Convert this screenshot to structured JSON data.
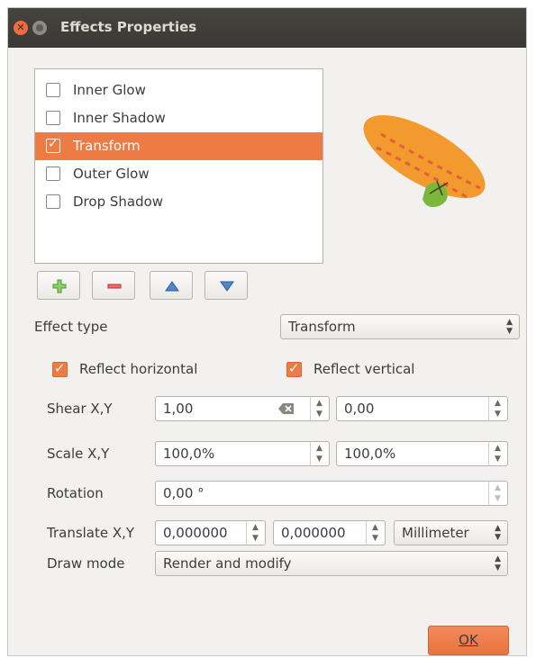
{
  "window": {
    "title": "Effects Properties"
  },
  "effects_list": [
    {
      "label": "Inner Glow",
      "checked": false,
      "selected": false
    },
    {
      "label": "Inner Shadow",
      "checked": false,
      "selected": false
    },
    {
      "label": "Transform",
      "checked": true,
      "selected": true
    },
    {
      "label": "Outer Glow",
      "checked": false,
      "selected": false
    },
    {
      "label": "Drop Shadow",
      "checked": false,
      "selected": false
    }
  ],
  "toolbar": {
    "add_icon": "plus-icon",
    "remove_icon": "minus-icon",
    "up_icon": "arrow-up-icon",
    "down_icon": "arrow-down-icon"
  },
  "effect_type": {
    "label": "Effect type",
    "value": "Transform"
  },
  "reflect": {
    "horizontal_label": "Reflect horizontal",
    "horizontal_checked": true,
    "vertical_label": "Reflect vertical",
    "vertical_checked": true
  },
  "shear": {
    "label": "Shear X,Y",
    "x": "1,00",
    "y": "0,00"
  },
  "scale": {
    "label": "Scale X,Y",
    "x": "100,0%",
    "y": "100,0%"
  },
  "rotation": {
    "label": "Rotation",
    "value": "0,00 °"
  },
  "translate": {
    "label": "Translate X,Y",
    "x": "0,000000",
    "y": "0,000000",
    "unit": "Millimeter"
  },
  "draw_mode": {
    "label": "Draw mode",
    "value": "Render and modify"
  },
  "ok_button": {
    "label": "OK"
  },
  "colors": {
    "accent": "#ee7a44",
    "titlebar": "#3c3b37"
  }
}
